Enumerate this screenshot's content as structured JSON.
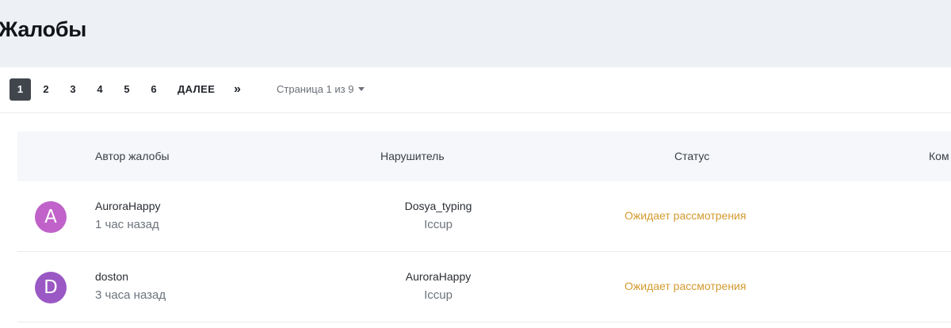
{
  "header": {
    "title": "Жалобы"
  },
  "pagination": {
    "pages": [
      "1",
      "2",
      "3",
      "4",
      "5",
      "6"
    ],
    "current": "1",
    "next_label": "ДАЛЕЕ",
    "last_label": "»",
    "page_of_label": "Страница 1 из 9"
  },
  "table": {
    "columns": [
      "Автор жалобы",
      "Нарушитель",
      "Статус",
      "Ком"
    ],
    "rows": [
      {
        "avatar_letter": "A",
        "avatar_color": "#c062c9",
        "author": "AuroraHappy",
        "time": "1 час назад",
        "violator": "Dosya_typing",
        "server": "Iccup",
        "status": "Ожидает рассмотрения"
      },
      {
        "avatar_letter": "D",
        "avatar_color": "#9a58c4",
        "author": "doston",
        "time": "3 часа назад",
        "violator": "AuroraHappy",
        "server": "Iccup",
        "status": "Ожидает рассмотрения"
      }
    ]
  },
  "colors": {
    "header_bg": "#edf0f5",
    "active_page_bg": "#41464d",
    "status_pending": "#d39a2e"
  }
}
